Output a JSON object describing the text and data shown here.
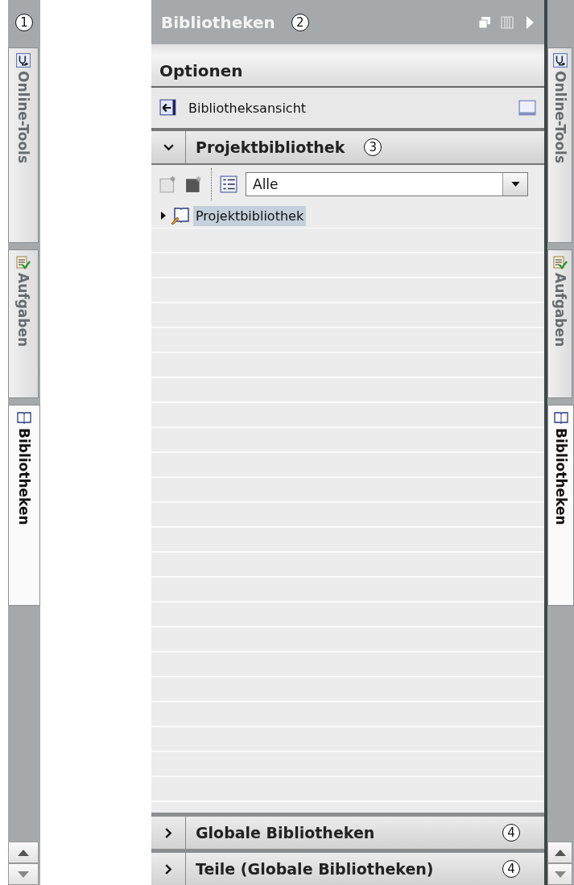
{
  "left_strip": {
    "callout": "1",
    "tabs": [
      {
        "label": "Online-Tools",
        "selected": false
      },
      {
        "label": "Aufgaben",
        "selected": false
      },
      {
        "label": "Bibliotheken",
        "selected": true
      }
    ]
  },
  "panel": {
    "title": "Bibliotheken",
    "callout": "2",
    "options_title": "Optionen",
    "view_button": "Bibliotheksansicht",
    "project_library": {
      "title": "Projektbibliothek",
      "callout": "3",
      "expanded": true,
      "filter": {
        "value": "Alle"
      },
      "tree": [
        {
          "label": "Projektbibliothek",
          "expanded": false,
          "selected": true
        }
      ]
    },
    "sections": [
      {
        "title": "Globale Bibliotheken",
        "callout": "4",
        "expanded": false
      },
      {
        "title": "Teile (Globale Bibliotheken)",
        "callout": "4",
        "expanded": false
      }
    ]
  },
  "right_strip": {
    "tabs": [
      {
        "label": "Online-Tools",
        "selected": false
      },
      {
        "label": "Aufgaben",
        "selected": false
      },
      {
        "label": "Bibliotheken",
        "selected": true
      }
    ]
  }
}
